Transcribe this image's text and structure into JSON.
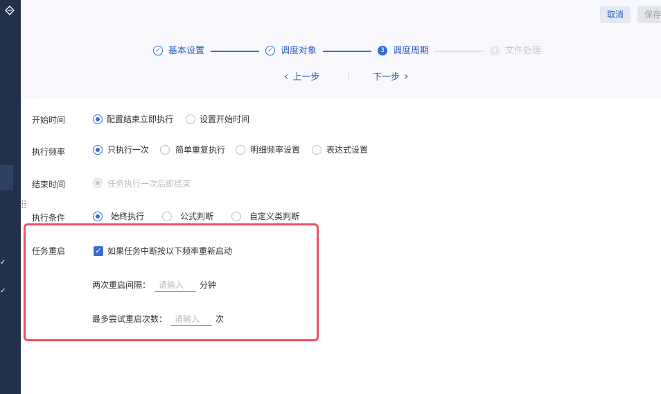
{
  "header": {
    "cancel_label": "取消",
    "save_label": "保存"
  },
  "steps": [
    {
      "label": "基本设置",
      "state": "done",
      "icon": "check-circle-icon"
    },
    {
      "label": "调度对象",
      "state": "done",
      "icon": "check-circle-icon"
    },
    {
      "label": "调度周期",
      "state": "current",
      "number": "3"
    },
    {
      "label": "文件处理",
      "state": "todo",
      "number": "4"
    }
  ],
  "nav": {
    "prev_label": "上一步",
    "next_label": "下一步",
    "prev_icon": "‹",
    "next_icon": "›"
  },
  "form": {
    "start_time": {
      "label": "开始时间",
      "options": [
        "配置结束立即执行",
        "设置开始时间"
      ],
      "selected": "配置结束立即执行"
    },
    "frequency": {
      "label": "执行频率",
      "options": [
        "只执行一次",
        "简单重复执行",
        "明细频率设置",
        "表达式设置"
      ],
      "selected": "只执行一次"
    },
    "end_time": {
      "label": "结束时间",
      "options": [
        "任务执行一次后即结束"
      ],
      "selected": "任务执行一次后即结束",
      "disabled": true
    },
    "condition": {
      "label": "执行条件",
      "options": [
        "始终执行",
        "公式判断",
        "自定义类判断"
      ],
      "selected": "始终执行"
    },
    "restart": {
      "label": "任务重启",
      "checkbox_label": "如果任务中断按以下频率重新启动",
      "checked": true,
      "interval_label": "两次重启间隔：",
      "interval_placeholder": "请输入",
      "interval_value": "",
      "interval_unit": "分钟",
      "attempts_label": "最多尝试重启次数：",
      "attempts_placeholder": "请输入",
      "attempts_value": "",
      "attempts_unit": "次"
    }
  },
  "colors": {
    "primary": "#3a6bd1",
    "sidebar": "#223049",
    "highlight": "#f04d5f"
  }
}
